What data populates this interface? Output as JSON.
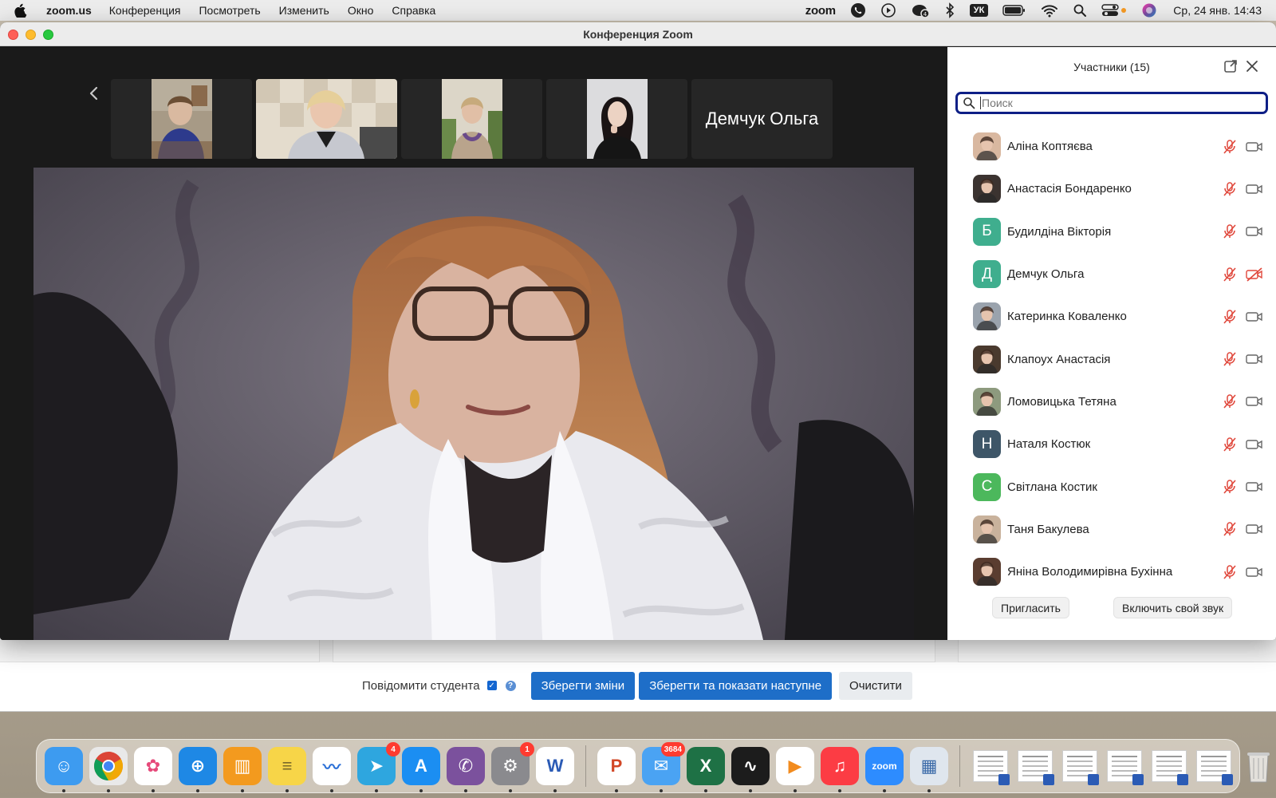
{
  "menubar": {
    "app_name": "zoom.us",
    "items": [
      "Конференция",
      "Посмотреть",
      "Изменить",
      "Окно",
      "Справка"
    ],
    "zoom_status": "zoom",
    "language": "УК",
    "clock": "Ср, 24 янв.  14:43"
  },
  "window": {
    "title": "Конференция Zoom"
  },
  "thumbnails": {
    "name_tile": "Демчук Ольга"
  },
  "participants": {
    "header": "Участники (15)",
    "search_placeholder": "Поиск",
    "list": [
      {
        "name": "Аліна Коптяєва",
        "avatar": "photo",
        "avatar_color": "#d9b8a0",
        "muted": true,
        "video_off": false
      },
      {
        "name": "Анастасія Бондаренко",
        "avatar": "photo",
        "avatar_color": "#3b3330",
        "muted": true,
        "video_off": false
      },
      {
        "name": "Будилдіна Вікторія",
        "avatar": "Б",
        "avatar_color": "#3fae8e",
        "muted": true,
        "video_off": false
      },
      {
        "name": "Демчук Ольга",
        "avatar": "Д",
        "avatar_color": "#3fae8e",
        "muted": true,
        "video_off": true
      },
      {
        "name": "Катеринка Коваленко",
        "avatar": "photo",
        "avatar_color": "#9aa3ad",
        "muted": true,
        "video_off": false
      },
      {
        "name": "Клапоух Анастасія",
        "avatar": "photo",
        "avatar_color": "#4a3a2e",
        "muted": true,
        "video_off": false
      },
      {
        "name": "Ломовицька Тетяна",
        "avatar": "photo",
        "avatar_color": "#8d9a7e",
        "muted": true,
        "video_off": false
      },
      {
        "name": "Наталя Костюк",
        "avatar": "Н",
        "avatar_color": "#3e5668",
        "muted": true,
        "video_off": false
      },
      {
        "name": "Світлана Костик",
        "avatar": "С",
        "avatar_color": "#4cb85c",
        "muted": true,
        "video_off": false
      },
      {
        "name": "Таня Бакулева",
        "avatar": "photo",
        "avatar_color": "#c9b29c",
        "muted": true,
        "video_off": false
      },
      {
        "name": "Яніна Володимирівна Бухінна",
        "avatar": "photo",
        "avatar_color": "#5a3d30",
        "muted": true,
        "video_off": false
      }
    ],
    "invite_label": "Пригласить",
    "unmute_self_label": "Включить свой звук"
  },
  "background_page": {
    "notify_label": "Повідомити студента",
    "notify_checked": true,
    "save_label": "Зберегти зміни",
    "save_next_label": "Зберегти та показати наступне",
    "clear_label": "Очистити"
  },
  "dock": {
    "apps": [
      {
        "name": "finder-icon",
        "color": "#3d9bf0",
        "glyph": "☺"
      },
      {
        "name": "chrome-icon",
        "color": "#e9e9e9",
        "glyph": ""
      },
      {
        "name": "photos-icon",
        "color": "#ffffff",
        "glyph": "✿"
      },
      {
        "name": "safari-icon",
        "color": "#1e88e5",
        "glyph": "⊕"
      },
      {
        "name": "books-icon",
        "color": "#f39a1e",
        "glyph": "▥"
      },
      {
        "name": "notes-icon",
        "color": "#f7d548",
        "glyph": "≡"
      },
      {
        "name": "freeform-icon",
        "color": "#ffffff",
        "glyph": "〰"
      },
      {
        "name": "telegram-icon",
        "color": "#2ea6df",
        "glyph": "➤",
        "badge": "4"
      },
      {
        "name": "app-store-icon",
        "color": "#1b8ef2",
        "glyph": "A"
      },
      {
        "name": "viber-icon",
        "color": "#7b519d",
        "glyph": "✆"
      },
      {
        "name": "system-settings-icon",
        "color": "#8a8a8e",
        "glyph": "⚙",
        "badge": "1"
      },
      {
        "name": "word-icon",
        "color": "#ffffff",
        "glyph": "W"
      },
      {
        "name": "powerpoint-icon",
        "color": "#ffffff",
        "glyph": "P"
      },
      {
        "name": "mail-icon",
        "color": "#4aa3f3",
        "glyph": "✉",
        "badge": "3684"
      },
      {
        "name": "excel-icon",
        "color": "#1e7145",
        "glyph": "X"
      },
      {
        "name": "activity-monitor-icon",
        "color": "#1c1c1c",
        "glyph": "∿"
      },
      {
        "name": "infuse-icon",
        "color": "#ffffff",
        "glyph": "▶"
      },
      {
        "name": "music-icon",
        "color": "#fc3c44",
        "glyph": "♫"
      },
      {
        "name": "zoom-icon",
        "color": "#2d8cff",
        "glyph": "zoom"
      },
      {
        "name": "preview-icon",
        "color": "#dfe6ee",
        "glyph": "▦"
      }
    ]
  }
}
